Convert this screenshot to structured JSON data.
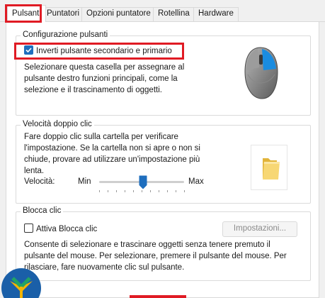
{
  "tabs": [
    {
      "label": "Pulsanti",
      "active": true
    },
    {
      "label": "Puntatori",
      "active": false
    },
    {
      "label": "Opzioni puntatore",
      "active": false
    },
    {
      "label": "Rotellina",
      "active": false
    },
    {
      "label": "Hardware",
      "active": false
    }
  ],
  "button_config": {
    "title": "Configurazione pulsanti",
    "checkbox_label": "Inverti pulsante secondario e primario",
    "checkbox_checked": true,
    "description_lines": [
      "Selezionare questa casella per assegnare al",
      "pulsante destro funzioni principali, come la",
      "selezione e il trascinamento di oggetti."
    ]
  },
  "double_click": {
    "title": "Velocità doppio clic",
    "description_lines": [
      "Fare doppio clic sulla cartella per verificare",
      "l'impostazione. Se la cartella non si apre o non si",
      "chiude, provare ad utilizzare un'impostazione più",
      "lenta."
    ],
    "speed_label": "Velocità:",
    "min_label": "Min",
    "max_label": "Max",
    "speed_level_fraction": 0.5
  },
  "click_lock": {
    "title": "Blocca clic",
    "checkbox_label": "Attiva Blocca clic",
    "checkbox_checked": false,
    "settings_button": "Impostazioni...",
    "description_lines": [
      "Consente di selezionare e trascinare oggetti senza tenere premuto il",
      "pulsante del mouse. Per selezionare, premere il pulsante del mouse. Per",
      "rilasciare, fare nuovamente clic sul pulsante."
    ]
  },
  "colors": {
    "highlight": "#e01b24",
    "accent": "#1e6ebe",
    "mouse_blue": "#1a8ce0"
  },
  "icons": [
    "mouse-illustration-icon",
    "folder-icon",
    "checkmark-icon",
    "site-logo-icon"
  ]
}
